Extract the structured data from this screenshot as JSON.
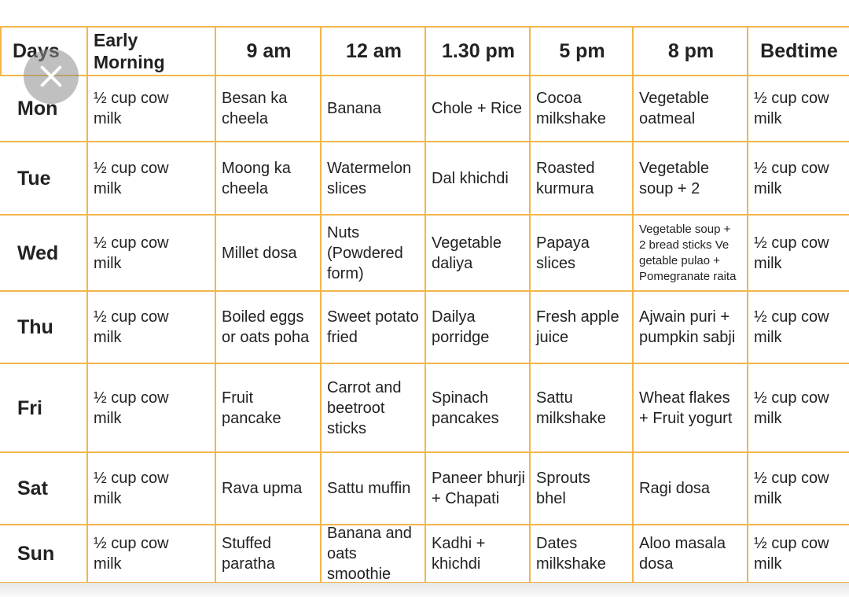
{
  "table": {
    "headers": [
      "Days",
      "Early\nMorning",
      "9 am",
      "12 am",
      "1.30 pm",
      "5 pm",
      "8 pm",
      "Bedtime"
    ],
    "rows": [
      {
        "day": "Mon",
        "cells": [
          "½ cup cow\nmilk",
          "Besan ka\ncheela",
          "Banana",
          "Chole + Rice",
          "Cocoa\nmilkshake",
          "Vegetable\noatmeal",
          "½ cup cow\nmilk"
        ]
      },
      {
        "day": "Tue",
        "cells": [
          "½ cup cow\nmilk",
          "Moong ka\ncheela",
          "Watermelon\nslices",
          "Dal khichdi",
          "Roasted\nkurmura",
          "Vegetable\nsoup + 2",
          "½ cup cow\nmilk"
        ]
      },
      {
        "day": "Wed",
        "cells": [
          "½ cup cow\nmilk",
          "Millet dosa",
          "Nuts\n(Powdered\nform)",
          "Vegetable\ndaliya",
          "Papaya\nslices",
          "Vegetable soup +\n2 bread sticks Ve\ngetable pulao +\nPomegranate raita",
          "½ cup cow\nmilk"
        ]
      },
      {
        "day": "Thu",
        "cells": [
          "½ cup cow\nmilk",
          "Boiled eggs\nor oats poha",
          "Sweet potato\nfried",
          "Dailya\nporridge",
          "Fresh apple\njuice",
          "Ajwain puri +\npumpkin sabji",
          "½ cup cow\nmilk"
        ]
      },
      {
        "day": "Fri",
        "cells": [
          "½ cup cow\nmilk",
          "Fruit\npancake",
          "Carrot and\nbeetroot\n sticks",
          "Spinach\npancakes",
          "Sattu\nmilkshake",
          "Wheat flakes\n+ Fruit yogurt",
          "½ cup cow\nmilk"
        ]
      },
      {
        "day": "Sat",
        "cells": [
          "½ cup cow\nmilk",
          "Rava upma",
          "Sattu muffin",
          "Paneer bhurji\n+ Chapati",
          "Sprouts\nbhel",
          "Ragi dosa",
          "½ cup cow\nmilk"
        ]
      },
      {
        "day": "Sun",
        "cells": [
          "½ cup cow\nmilk",
          "Stuffed\nparatha",
          "Banana and\noats smoothie",
          "Kadhi +\nkhichdi",
          "Dates\nmilkshake",
          "Aloo masala\ndosa",
          "½ cup cow\nmilk"
        ]
      }
    ]
  },
  "overlay": {
    "close_icon": "close-icon"
  },
  "colors": {
    "grid": "#f2b64a",
    "close_bg": "#8c8c8c"
  }
}
